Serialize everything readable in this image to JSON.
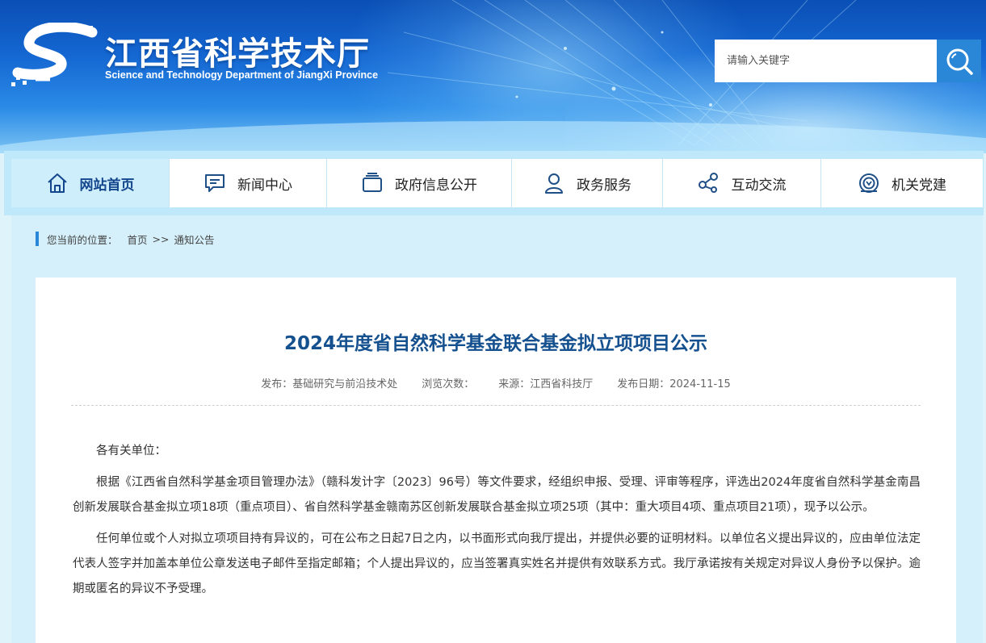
{
  "header": {
    "title_cn": "江西省科学技术厅",
    "title_en": "Science and Technology Department of JiangXi Province",
    "search_placeholder": "请输入关键字"
  },
  "nav": {
    "items": [
      {
        "label": "网站首页",
        "icon": "home-icon"
      },
      {
        "label": "新闻中心",
        "icon": "news-icon"
      },
      {
        "label": "政府信息公开",
        "icon": "folder-icon"
      },
      {
        "label": "政务服务",
        "icon": "user-icon"
      },
      {
        "label": "互动交流",
        "icon": "share-icon"
      },
      {
        "label": "机关党建",
        "icon": "party-icon"
      }
    ]
  },
  "breadcrumb": {
    "prefix": "您当前的位置：",
    "home": "首页",
    "separator": ">>",
    "current": "通知公告"
  },
  "article": {
    "title": "2024年度省自然科学基金联合基金拟立项项目公示",
    "publisher": "发布：基础研究与前沿技术处",
    "views": "浏览次数：",
    "source": "来源：江西省科技厅",
    "date": "发布日期：2024-11-15",
    "salutation": "各有关单位：",
    "paragraph1": "根据《江西省自然科学基金项目管理办法》（赣科发计字〔2023〕96号）等文件要求，经组织申报、受理、评审等程序，评选出2024年度省自然科学基金南昌创新发展联合基金拟立项18项（重点项目）、省自然科学基金赣南苏区创新发展联合基金拟立项25项（其中：重大项目4项、重点项目21项），现予以公示。",
    "paragraph2": "任何单位或个人对拟立项项目持有异议的，可在公布之日起7日之内，以书面形式向我厅提出，并提供必要的证明材料。以单位名义提出异议的，应由单位法定代表人签字并加盖本单位公章发送电子邮件至指定邮箱；个人提出异议的，应当签署真实姓名并提供有效联系方式。我厅承诺按有关规定对异议人身份予以保护。逾期或匿名的异议不予受理。"
  }
}
